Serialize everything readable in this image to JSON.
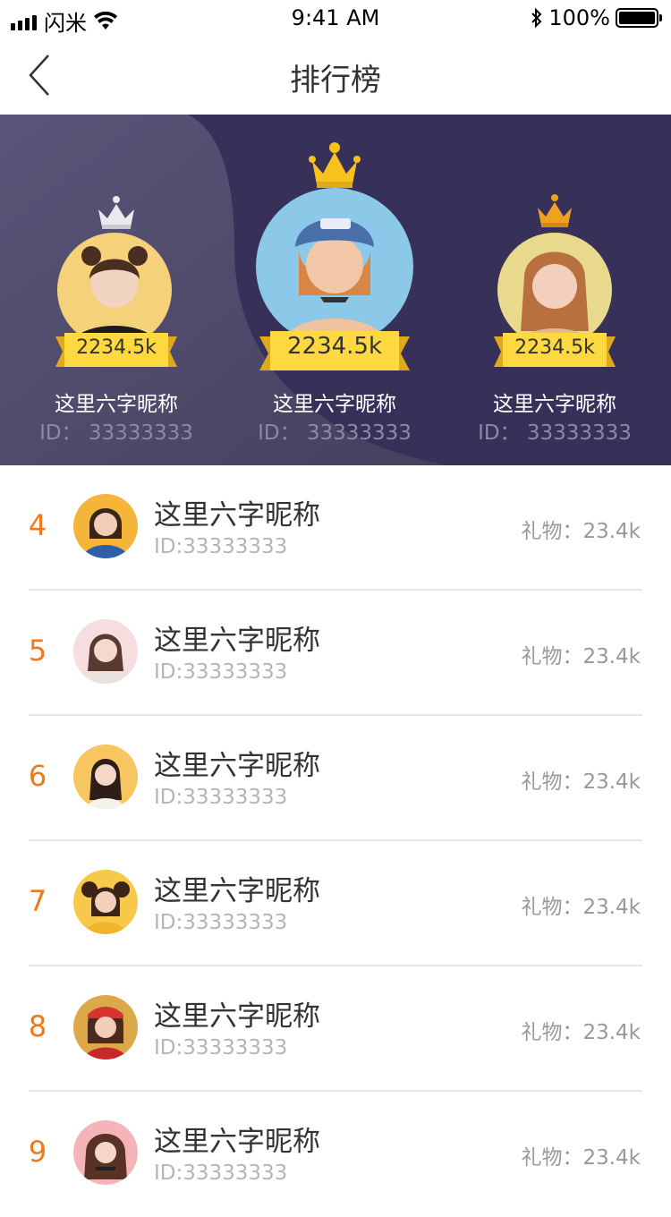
{
  "status_bar": {
    "carrier": "闪米",
    "time": "9:41 AM",
    "battery": "100%"
  },
  "nav": {
    "title": "排行榜"
  },
  "top_three": [
    {
      "rank": 2,
      "score": "2234.5k",
      "name": "这里六字昵称",
      "id": "ID： 33333333",
      "crown": "silver-crown-icon"
    },
    {
      "rank": 1,
      "score": "2234.5k",
      "name": "这里六字昵称",
      "id": "ID： 33333333",
      "crown": "gold-crown-icon"
    },
    {
      "rank": 3,
      "score": "2234.5k",
      "name": "这里六字昵称",
      "id": "ID： 33333333",
      "crown": "bronze-crown-icon"
    }
  ],
  "list": [
    {
      "rank": "4",
      "name": "这里六字昵称",
      "id": "ID:33333333",
      "gift": "礼物：23.4k"
    },
    {
      "rank": "5",
      "name": "这里六字昵称",
      "id": "ID:33333333",
      "gift": "礼物：23.4k"
    },
    {
      "rank": "6",
      "name": "这里六字昵称",
      "id": "ID:33333333",
      "gift": "礼物：23.4k"
    },
    {
      "rank": "7",
      "name": "这里六字昵称",
      "id": "ID:33333333",
      "gift": "礼物：23.4k"
    },
    {
      "rank": "8",
      "name": "这里六字昵称",
      "id": "ID:33333333",
      "gift": "礼物：23.4k"
    },
    {
      "rank": "9",
      "name": "这里六字昵称",
      "id": "ID:33333333",
      "gift": "礼物：23.4k"
    }
  ],
  "colors": {
    "banner_bg": "#3a3459",
    "rank_number": "#ee7a1c",
    "ribbon": "#ffd93f",
    "gold_crown": "#f7c21b",
    "silver_crown": "#e9e9ee",
    "bronze_crown": "#f0a21e"
  }
}
